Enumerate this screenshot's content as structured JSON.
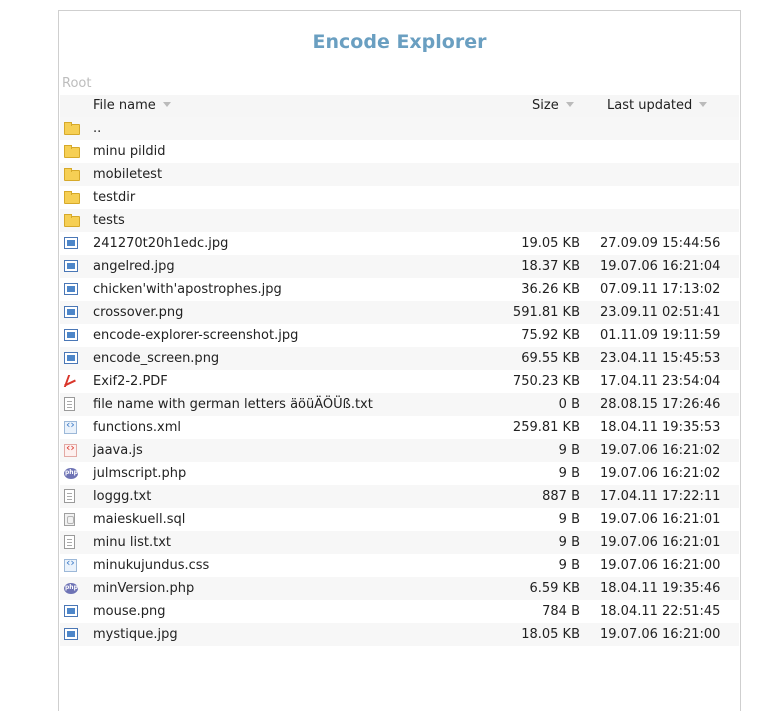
{
  "title": "Encode Explorer",
  "breadcrumb": "Root",
  "columns": {
    "name": "File name",
    "size": "Size",
    "updated": "Last updated"
  },
  "colors": {
    "title": "#6a9fc1",
    "folder": "#f6cf54",
    "image": "#4d86c9",
    "pdf": "#d9352a"
  },
  "rows": [
    {
      "icon": "folder",
      "name": "..",
      "size": "",
      "date": ""
    },
    {
      "icon": "folder",
      "name": "minu pildid",
      "size": "",
      "date": ""
    },
    {
      "icon": "folder",
      "name": "mobiletest",
      "size": "",
      "date": ""
    },
    {
      "icon": "folder",
      "name": "testdir",
      "size": "",
      "date": ""
    },
    {
      "icon": "folder",
      "name": "tests",
      "size": "",
      "date": ""
    },
    {
      "icon": "image",
      "name": "241270t20h1edc.jpg",
      "size": "19.05 KB",
      "date": "27.09.09 15:44:56"
    },
    {
      "icon": "image",
      "name": "angelred.jpg",
      "size": "18.37 KB",
      "date": "19.07.06 16:21:04"
    },
    {
      "icon": "image",
      "name": "chicken'with'apostrophes.jpg",
      "size": "36.26 KB",
      "date": "07.09.11 17:13:02"
    },
    {
      "icon": "image",
      "name": "crossover.png",
      "size": "591.81 KB",
      "date": "23.09.11 02:51:41"
    },
    {
      "icon": "image",
      "name": "encode-explorer-screenshot.jpg",
      "size": "75.92 KB",
      "date": "01.11.09 19:11:59"
    },
    {
      "icon": "image",
      "name": "encode_screen.png",
      "size": "69.55 KB",
      "date": "23.04.11 15:45:53"
    },
    {
      "icon": "pdf",
      "name": "Exif2-2.PDF",
      "size": "750.23 KB",
      "date": "17.04.11 23:54:04"
    },
    {
      "icon": "txt",
      "name": "file name with german letters äöüÄÖÜß.txt",
      "size": "0 B",
      "date": "28.08.15 17:26:46"
    },
    {
      "icon": "code",
      "name": "functions.xml",
      "size": "259.81 KB",
      "date": "18.04.11 19:35:53"
    },
    {
      "icon": "js",
      "name": "jaava.js",
      "size": "9 B",
      "date": "19.07.06 16:21:02"
    },
    {
      "icon": "php",
      "name": "julmscript.php",
      "size": "9 B",
      "date": "19.07.06 16:21:02"
    },
    {
      "icon": "txt",
      "name": "loggg.txt",
      "size": "887 B",
      "date": "17.04.11 17:22:11"
    },
    {
      "icon": "sql",
      "name": "maieskuell.sql",
      "size": "9 B",
      "date": "19.07.06 16:21:01"
    },
    {
      "icon": "txt",
      "name": "minu list.txt",
      "size": "9 B",
      "date": "19.07.06 16:21:01"
    },
    {
      "icon": "code",
      "name": "minukujundus.css",
      "size": "9 B",
      "date": "19.07.06 16:21:00"
    },
    {
      "icon": "php",
      "name": "minVersion.php",
      "size": "6.59 KB",
      "date": "18.04.11 19:35:46"
    },
    {
      "icon": "image",
      "name": "mouse.png",
      "size": "784 B",
      "date": "18.04.11 22:51:45"
    },
    {
      "icon": "image",
      "name": "mystique.jpg",
      "size": "18.05 KB",
      "date": "19.07.06 16:21:00"
    }
  ]
}
